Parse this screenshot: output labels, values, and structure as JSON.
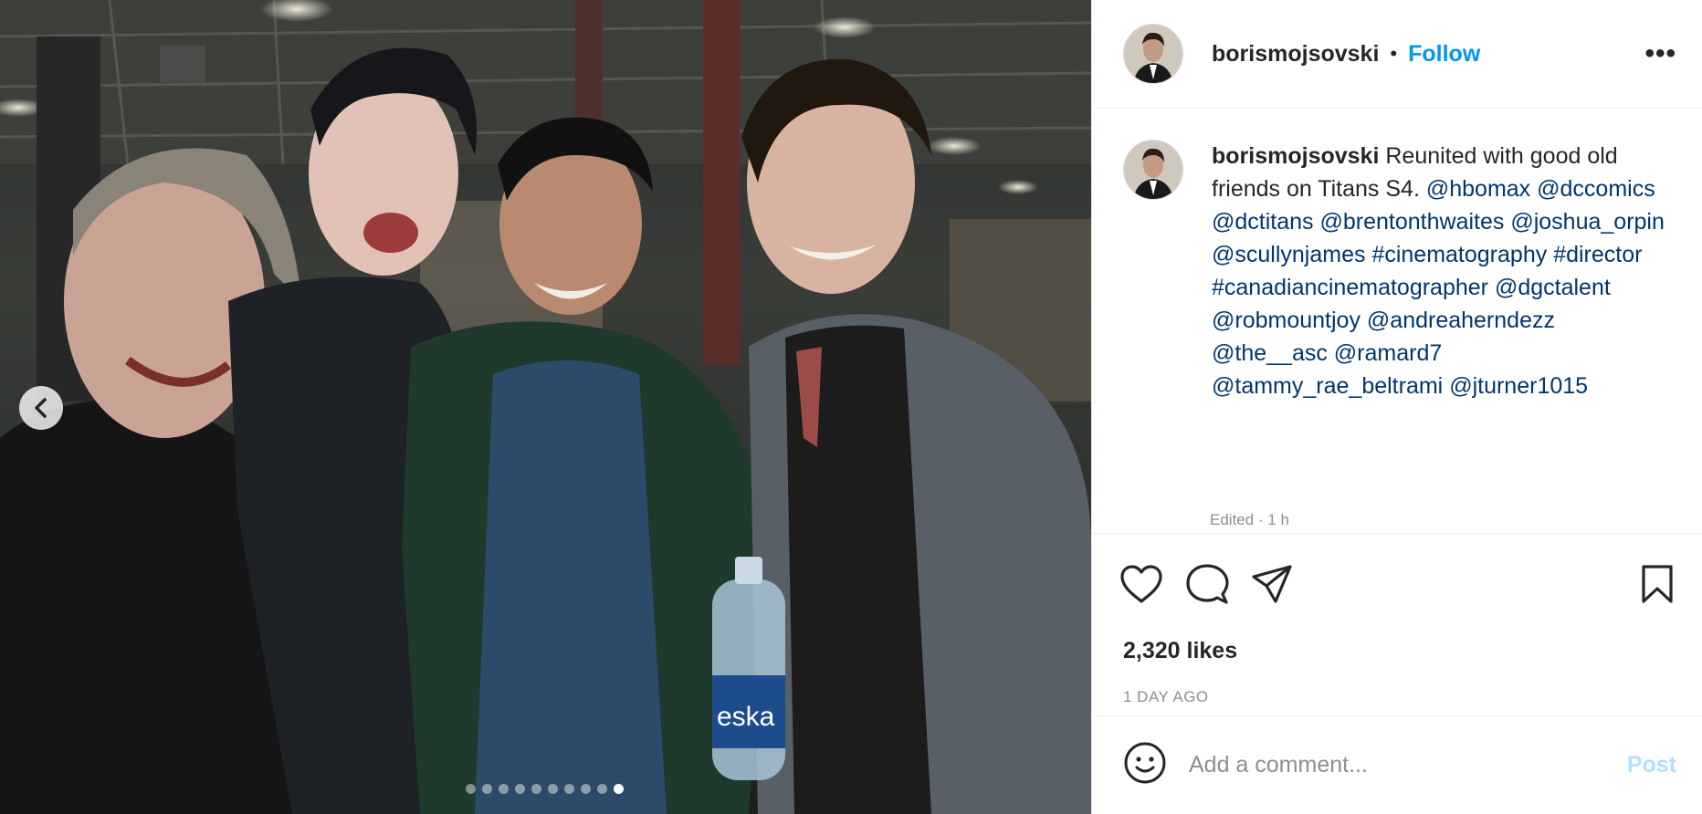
{
  "post": {
    "username": "borismojsovski",
    "separator": "•",
    "follow_label": "Follow",
    "more_label": "•••",
    "caption": {
      "username": "borismojsovski",
      "text": "Reunited with good old friends on Titans S4.",
      "tags": [
        "@hbomax",
        "@dccomics",
        "@dctitans",
        "@brentonthwaites",
        "@joshua_orpin",
        "@scullynjames",
        "#cinematography",
        "#director",
        "#canadiancinematographer",
        "@dgctalent",
        "@robmountjoy",
        "@andreaherndezz",
        "@the__asc",
        "@ramard7",
        "@tammy_rae_beltrami",
        "@jturner1015"
      ],
      "edited": "Edited · 1 h"
    },
    "likes": "2,320 likes",
    "timestamp": "1 DAY AGO",
    "comment_placeholder": "Add a comment...",
    "post_label": "Post",
    "carousel": {
      "total": 10,
      "active_index": 9
    },
    "photo": {
      "bottle_label": "eska"
    }
  },
  "colors": {
    "link": "#00376b",
    "follow": "#0095f6",
    "post_disabled": "#b2dffc",
    "muted": "#8e8e8e"
  }
}
